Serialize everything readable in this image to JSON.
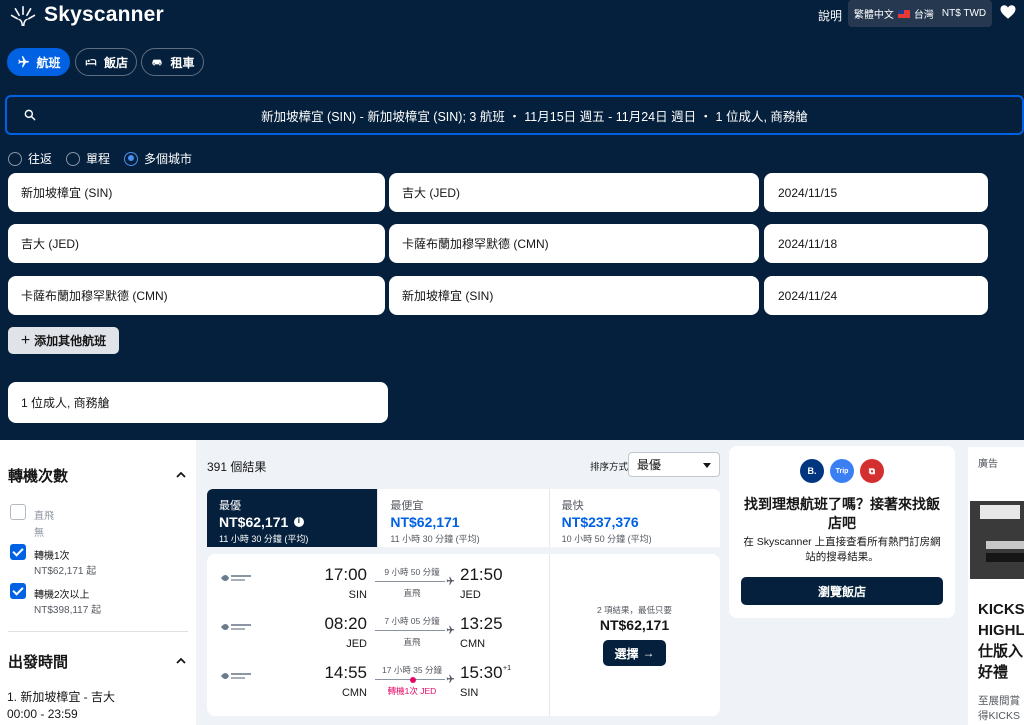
{
  "header": {
    "logo_text": "Skyscanner",
    "help": "說明",
    "language": "繁體中文",
    "region": "台灣",
    "currency": "NT$ TWD"
  },
  "nav_pills": [
    {
      "label": "航班",
      "icon": "plane-icon",
      "active": true
    },
    {
      "label": "飯店",
      "icon": "bed-icon",
      "active": false
    },
    {
      "label": "租車",
      "icon": "car-icon",
      "active": false
    }
  ],
  "search_summary": "新加坡樟宜 (SIN) - 新加坡樟宜 (SIN); 3 航班 ・ 11月15日 週五 - 11月24日 週日 ・ 1 位成人, 商務艙",
  "trip_type": {
    "options": [
      "往返",
      "單程",
      "多個城市"
    ],
    "selected": "多個城市"
  },
  "legs": [
    {
      "from": "新加坡樟宜 (SIN)",
      "to": "吉大 (JED)",
      "date": "2024/11/15"
    },
    {
      "from": "吉大 (JED)",
      "to": "卡薩布蘭加穆罕默德 (CMN)",
      "date": "2024/11/18"
    },
    {
      "from": "卡薩布蘭加穆罕默德 (CMN)",
      "to": "新加坡樟宜 (SIN)",
      "date": "2024/11/24"
    }
  ],
  "add_flight": "添加其他航班",
  "travellers": "1 位成人, 商務艙",
  "filters": {
    "stops_title": "轉機次數",
    "options": [
      {
        "label": "直飛",
        "sub": "無",
        "checked": false
      },
      {
        "label": "轉機1次",
        "sub": "NT$62,171 起",
        "checked": true
      },
      {
        "label": "轉機2次以上",
        "sub": "NT$398,117 起",
        "checked": true
      }
    ],
    "departure_title": "出發時間",
    "departure_route": "1. 新加坡樟宜 - 吉大",
    "departure_range": "00:00 - 23:59"
  },
  "results": {
    "count": "391 個結果",
    "sort_label": "排序方式",
    "sort_value": "最優"
  },
  "tabs": [
    {
      "name": "最優",
      "price": "NT$62,171",
      "duration": "11 小時 30 分鐘 (平均)"
    },
    {
      "name": "最便宜",
      "price": "NT$62,171",
      "duration": "11 小時 30 分鐘 (平均)"
    },
    {
      "name": "最快",
      "price": "NT$237,376",
      "duration": "10 小時 50 分鐘 (平均)"
    }
  ],
  "itinerary": {
    "airline": "Saudia",
    "legs": [
      {
        "dep_time": "17:00",
        "dep_code": "SIN",
        "duration": "9 小時 50 分鐘",
        "stop": "直飛",
        "arr_time": "21:50",
        "arr_code": "JED",
        "day_offset": ""
      },
      {
        "dep_time": "08:20",
        "dep_code": "JED",
        "duration": "7 小時 05 分鐘",
        "stop": "直飛",
        "arr_time": "13:25",
        "arr_code": "CMN",
        "day_offset": ""
      },
      {
        "dep_time": "14:55",
        "dep_code": "CMN",
        "duration": "17 小時 35 分鐘",
        "stop": "轉機1次 JED",
        "arr_time": "15:30",
        "arr_code": "SIN",
        "day_offset": "+1"
      }
    ],
    "deal_note": "2 項結果，最低只要",
    "deal_price": "NT$62,171",
    "select_label": "選擇"
  },
  "hotel_promo": {
    "partners": [
      "B.",
      "Trip",
      "⧉"
    ],
    "title": "找到理想航班了嗎？接著來找飯店吧",
    "description": "在 Skyscanner 上直接查看所有熱門訂房網站的搜尋結果。",
    "button": "瀏覽飯店"
  },
  "ad": {
    "label": "廣告",
    "lines": [
      "KICKS",
      "HIGHLI",
      "仕版入",
      "好禮"
    ],
    "small_lines": [
      "至展間賞",
      "得KICKS"
    ]
  },
  "colors": {
    "navy": "#05203c",
    "accent_blue": "#0062e3",
    "stop_red": "#e70866"
  }
}
